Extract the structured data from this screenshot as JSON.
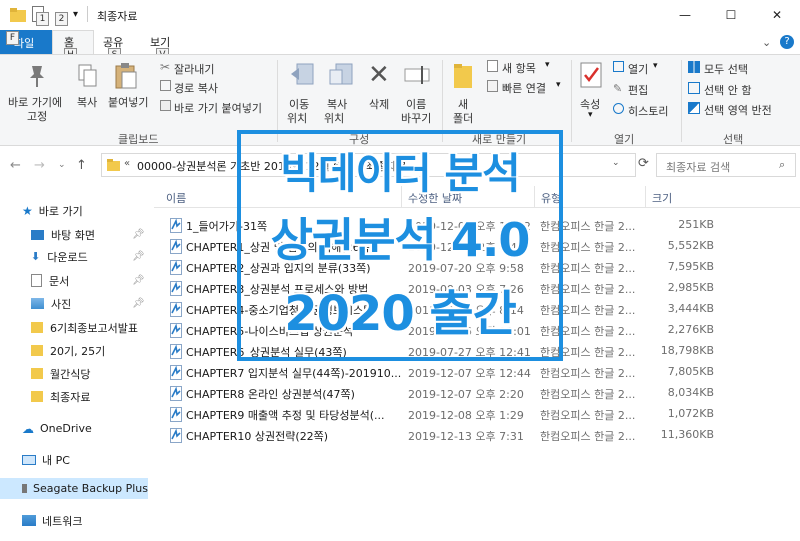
{
  "window": {
    "title": "최종자료",
    "minimize_glyph": "—",
    "maximize_glyph": "☐",
    "close_glyph": "✕"
  },
  "keytips": {
    "qat1": "1",
    "qat2": "2",
    "file": "F",
    "home": "H",
    "share": "S",
    "view": "V"
  },
  "tabs": {
    "file": "파일",
    "home": "홈",
    "share": "공유",
    "view": "보기"
  },
  "ribbon": {
    "clipboard": {
      "pin_label_1": "바로 가기에",
      "pin_label_2": "고정",
      "copy": "복사",
      "paste": "붙여넣기",
      "cut": "잘라내기",
      "copy_path": "경로 복사",
      "paste_shortcut": "바로 가기 붙여넣기",
      "group": "클립보드"
    },
    "organize": {
      "move_1": "이동",
      "move_2": "위치",
      "copyto_1": "복사",
      "copyto_2": "위치",
      "delete": "삭제",
      "rename_1": "이름",
      "rename_2": "바꾸기",
      "group": "구성"
    },
    "new": {
      "folder_1": "새",
      "folder_2": "폴더",
      "new_item": "새 항목",
      "easy_access": "빠른 연결",
      "group": "새로 만들기"
    },
    "open": {
      "properties": "속성",
      "open": "열기",
      "edit": "편집",
      "history": "히스토리",
      "group": "열기"
    },
    "select": {
      "select_all": "모두 선택",
      "select_none": "선택 안 함",
      "invert": "선택 영역 반전",
      "group": "선택"
    }
  },
  "address": {
    "path": "00000-상권분석론 기초반 2019년 12월 6일",
    "current": "최종자료",
    "search_placeholder": "최종자료 검색"
  },
  "columns": {
    "name": "이름",
    "date": "수정한 날짜",
    "type": "유형",
    "size": "크기"
  },
  "nav": {
    "quick_access": "바로 가기",
    "desktop": "바탕 화면",
    "downloads": "다운로드",
    "documents": "문서",
    "pictures": "사진",
    "f1": "6기최종보고서발표",
    "f2": "20기, 25기",
    "f3": "월간식당",
    "f4": "최종자료",
    "onedrive": "OneDrive",
    "pc": "내 PC",
    "seagate": "Seagate Backup Plus",
    "network": "네트워크"
  },
  "files": [
    {
      "name": "1_들어가기-31쪽",
      "date": "2019-12-05 오후 11:42",
      "type": "한컴오피스 한글 2...",
      "size": "251KB"
    },
    {
      "name": "CHAPTER1_상권 및 입지의 이해(26쪽)",
      "date": "2019-12-09 오후 4:44",
      "type": "한컴오피스 한글 2...",
      "size": "5,552KB"
    },
    {
      "name": "CHAPTER2_상권과 입지의 분류(33쪽)",
      "date": "2019-07-20 오후 9:58",
      "type": "한컴오피스 한글 2...",
      "size": "7,595KB"
    },
    {
      "name": "CHAPTER3_상권분석 프로세스와 방법",
      "date": "2019-09-03 오후 7:26",
      "type": "한컴오피스 한글 2...",
      "size": "2,985KB"
    },
    {
      "name": "CHAPTER4-중소기업청 상권정보시스템",
      "date": "2019-12-05 오후 8:14",
      "type": "한컴오피스 한글 2...",
      "size": "3,444KB"
    },
    {
      "name": "CHAPTER5-나이스비즈맵 상권분석",
      "date": "2019-12-06 오전 12:01",
      "type": "한컴오피스 한글 2...",
      "size": "2,276KB"
    },
    {
      "name": "CHAPTER6_상권분석 실무(43쪽)",
      "date": "2019-07-27 오후 12:41",
      "type": "한컴오피스 한글 2...",
      "size": "18,798KB"
    },
    {
      "name": "CHAPTER7 입지분석 실무(44쪽)-201910...",
      "date": "2019-12-07 오후 12:44",
      "type": "한컴오피스 한글 2...",
      "size": "7,805KB"
    },
    {
      "name": "CHAPTER8 온라인 상권분석(47쪽)",
      "date": "2019-12-07 오후 2:20",
      "type": "한컴오피스 한글 2...",
      "size": "8,034KB"
    },
    {
      "name": "CHAPTER9 매출액 추정  및 타당성분석(...",
      "date": "2019-12-08 오후 1:29",
      "type": "한컴오피스 한글 2...",
      "size": "1,072KB"
    },
    {
      "name": "CHAPTER10 상권전략(22쪽)",
      "date": "2019-12-13 오후 7:31",
      "type": "한컴오피스 한글 2...",
      "size": "11,360KB"
    }
  ],
  "banner": {
    "line1": "빅데이터 분석",
    "line2": "상권분석 4.0",
    "line3": "2020 출간"
  },
  "colors": {
    "accent": "#1979ca",
    "banner": "#1d8fe0",
    "selection": "#cce8ff"
  }
}
